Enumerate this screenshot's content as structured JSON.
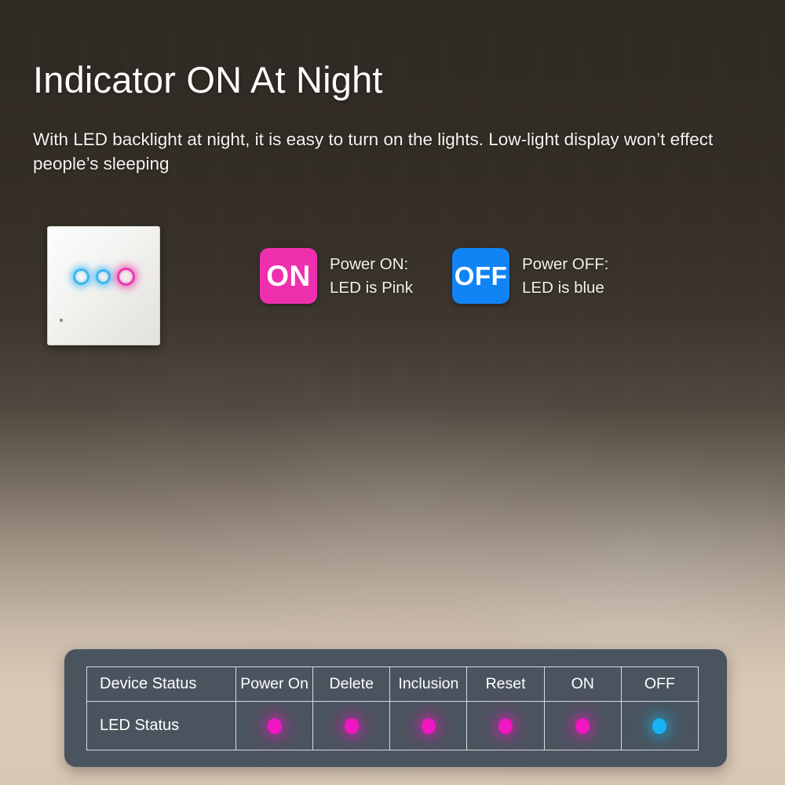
{
  "hero": {
    "title": "Indicator ON At Night",
    "subtitle": "With LED backlight at night,   it is easy to turn on the lights. Low-light display won’t effect people’s sleeping"
  },
  "device": {
    "name": "touch-wall-switch",
    "leds": [
      {
        "color_name": "blue",
        "hex": "#3ab6f0"
      },
      {
        "color_name": "blue",
        "hex": "#3ab6f0"
      },
      {
        "color_name": "pink",
        "hex": "#e838ae"
      }
    ]
  },
  "legend": [
    {
      "badge_label": "ON",
      "badge_hex": "#ee2fae",
      "line1": "Power ON:",
      "line2": "LED is Pink"
    },
    {
      "badge_label": "OFF",
      "badge_hex": "#1084f5",
      "line1": "Power OFF:",
      "line2": "LED is blue"
    }
  ],
  "status_table": {
    "row_labels": [
      "Device Status",
      "LED Status"
    ],
    "columns": [
      "Power On",
      "Delete",
      "Inclusion",
      "Reset",
      "ON",
      "OFF"
    ],
    "led_states": [
      {
        "color_name": "pink",
        "hex": "#f016c2"
      },
      {
        "color_name": "pink",
        "hex": "#f016c2"
      },
      {
        "color_name": "pink",
        "hex": "#f016c2"
      },
      {
        "color_name": "pink",
        "hex": "#f016c2"
      },
      {
        "color_name": "pink",
        "hex": "#f016c2"
      },
      {
        "color_name": "blue",
        "hex": "#17b2f2"
      }
    ]
  },
  "colors": {
    "panel_bg": "#4a545e",
    "panel_border": "#d6dade",
    "pink": "#f016c2",
    "blue": "#17b2f2",
    "text_light": "#ffffff"
  }
}
